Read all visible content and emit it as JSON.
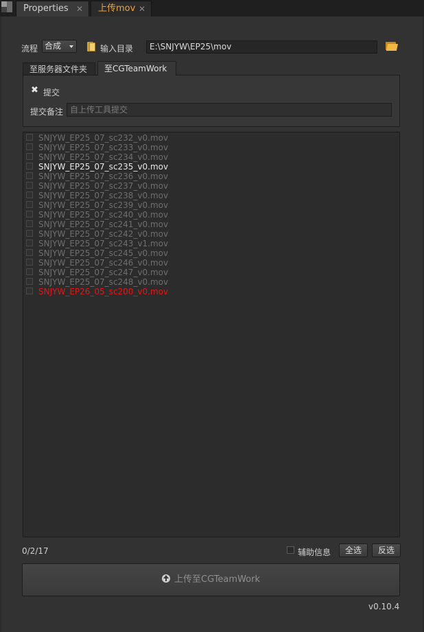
{
  "tabs": [
    {
      "label": "Properties",
      "close": "✕"
    },
    {
      "label": "上传mov",
      "close": "✕"
    }
  ],
  "colors": {
    "active_tab": "#f0a23a",
    "error_item": "#e01818",
    "dim_item": "#6e6e6e",
    "normal_item": "#e8e8e8"
  },
  "process": {
    "label": "流程",
    "value": "合成"
  },
  "input_dir": {
    "label": "输入目录",
    "path": "E:\\SNJYW\\EP25\\mov",
    "browse_icon": "folder-open-icon"
  },
  "subtabs": [
    {
      "label": "至服务器文件夹"
    },
    {
      "label": "至CGTeamWork"
    }
  ],
  "submit": {
    "checkbox_label": "提交",
    "checked": true,
    "note_label": "提交备注",
    "note_placeholder": "自上传工具提交"
  },
  "files": [
    {
      "name": "SNJYW_EP25_07_sc232_v0.mov",
      "state": "dim"
    },
    {
      "name": "SNJYW_EP25_07_sc233_v0.mov",
      "state": "dim"
    },
    {
      "name": "SNJYW_EP25_07_sc234_v0.mov",
      "state": "dim"
    },
    {
      "name": "SNJYW_EP25_07_sc235_v0.mov",
      "state": "normal"
    },
    {
      "name": "SNJYW_EP25_07_sc236_v0.mov",
      "state": "dim"
    },
    {
      "name": "SNJYW_EP25_07_sc237_v0.mov",
      "state": "dim"
    },
    {
      "name": "SNJYW_EP25_07_sc238_v0.mov",
      "state": "dim"
    },
    {
      "name": "SNJYW_EP25_07_sc239_v0.mov",
      "state": "dim"
    },
    {
      "name": "SNJYW_EP25_07_sc240_v0.mov",
      "state": "dim"
    },
    {
      "name": "SNJYW_EP25_07_sc241_v0.mov",
      "state": "dim"
    },
    {
      "name": "SNJYW_EP25_07_sc242_v0.mov",
      "state": "dim"
    },
    {
      "name": "SNJYW_EP25_07_sc243_v1.mov",
      "state": "dim"
    },
    {
      "name": "SNJYW_EP25_07_sc245_v0.mov",
      "state": "dim"
    },
    {
      "name": "SNJYW_EP25_07_sc246_v0.mov",
      "state": "dim"
    },
    {
      "name": "SNJYW_EP25_07_sc247_v0.mov",
      "state": "dim"
    },
    {
      "name": "SNJYW_EP25_07_sc248_v0.mov",
      "state": "dim"
    },
    {
      "name": "SNJYW_EP26_05_sc200_v0.mov",
      "state": "error"
    }
  ],
  "footer": {
    "count": "0/2/17",
    "aux_label": "辅助信息",
    "select_all": "全选",
    "invert": "反选",
    "upload_label": "上传至CGTeamWork",
    "upload_icon": "arrow-up-circle-icon",
    "version": "v0.10.4"
  }
}
